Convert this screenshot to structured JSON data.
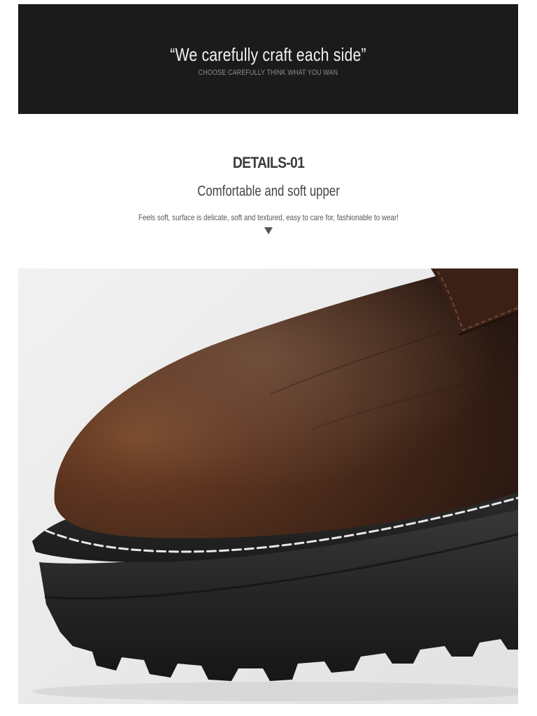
{
  "banner": {
    "quote": "“We carefully craft each side”",
    "tagline": "CHOOSE CAREFULLY THINK WHAT YOU WAN"
  },
  "details": {
    "heading": "DETAILS-01",
    "subtitle": "Comfortable and soft upper",
    "description": "Feels soft, surface is delicate, soft and textured, easy to care for, fashionable to wear!"
  },
  "colors": {
    "banner_background": "#1b1b1b",
    "leather": "#4a2a1a",
    "sole": "#2a2a2a",
    "stitching": "#e8e8e8",
    "photo_background": "#ececec"
  },
  "icons": {
    "down_arrow": "down-triangle-icon"
  }
}
